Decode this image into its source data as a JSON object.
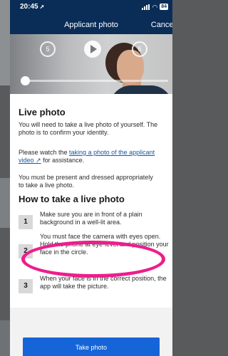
{
  "status_bar": {
    "time": "20:45",
    "battery": "84"
  },
  "header": {
    "title": "Applicant photo",
    "cancel_label": "Cancel"
  },
  "video": {
    "rewind_label": "5",
    "forward_label": "5"
  },
  "live_photo": {
    "heading": "Live photo",
    "para1": "You will need to take a live photo of yourself. The photo is to confirm your identity.",
    "para2_prefix": "Please watch the ",
    "para2_link": "taking a photo of the applicant video",
    "para2_link_icon": "↗",
    "para2_suffix": " for assistance.",
    "para3_line1": "You must be present and dressed appropriately",
    "para3_line2": "to take a live photo."
  },
  "how_to": {
    "heading": "How to take a live photo",
    "steps": [
      {
        "num": "1",
        "text": "Make sure you are in front of a plain background in a well-lit area."
      },
      {
        "num": "2",
        "text": "You must face the camera with eyes open. Hold the phone at eye-level and position your face in the circle."
      },
      {
        "num": "3",
        "text": "When your face is in the correct position, the app will take the picture."
      }
    ]
  },
  "take_photo_label": "Take photo",
  "colors": {
    "header": "#0a2d57",
    "button": "#1565d8",
    "highlight": "#ec1e8c",
    "link": "#1a56a6"
  }
}
